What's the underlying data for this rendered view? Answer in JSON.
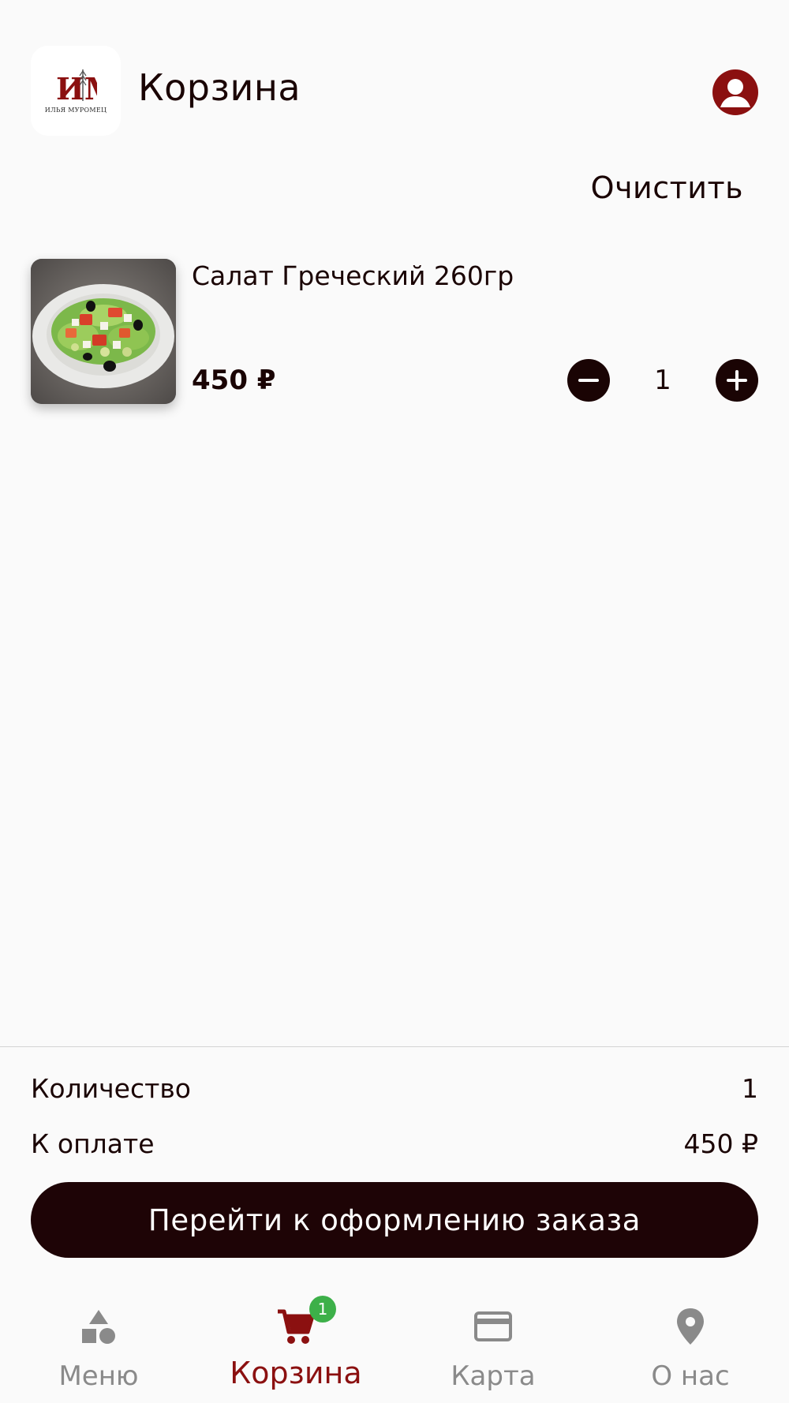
{
  "header": {
    "logo_text": "ИЛЬЯ МУРОМЕЦ",
    "title": "Корзина",
    "profile_icon": "account-circle-icon"
  },
  "actions": {
    "clear_label": "Очистить"
  },
  "cart": {
    "items": [
      {
        "name": "Салат Греческий 260гр",
        "price": "450 ₽",
        "quantity": "1"
      }
    ]
  },
  "summary": {
    "quantity_label": "Количество",
    "quantity_value": "1",
    "total_label": "К оплате",
    "total_value": "450 ₽",
    "checkout_label": "Перейти к оформлению заказа"
  },
  "bottom_nav": {
    "items": [
      {
        "label": "Меню",
        "icon": "shapes-icon"
      },
      {
        "label": "Корзина",
        "icon": "cart-icon",
        "badge": "1",
        "active": true
      },
      {
        "label": "Карта",
        "icon": "credit-card-icon"
      },
      {
        "label": "О нас",
        "icon": "map-pin-icon"
      }
    ]
  },
  "colors": {
    "accent": "#8b1010",
    "dark": "#1a0404",
    "badge": "#3db049",
    "inactive": "#8a8a8a",
    "background": "#fafafa"
  }
}
